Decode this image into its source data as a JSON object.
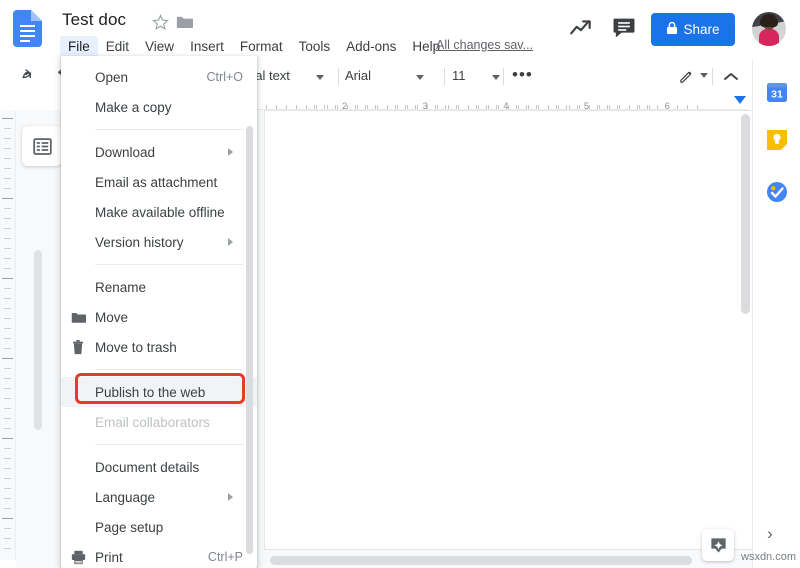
{
  "header": {
    "doc_title": "Test doc",
    "save_status": "All changes sav...",
    "share_label": "Share",
    "docs_icon": "google-docs-icon",
    "star_icon": "star-outline-icon",
    "folder_icon": "folder-icon",
    "trend_icon": "activity-dashboard-icon",
    "comment_icon": "comment-history-icon",
    "lock_icon": "lock-icon",
    "avatar_icon": "user-avatar"
  },
  "menubar": {
    "items": [
      {
        "label": "File",
        "active": true
      },
      {
        "label": "Edit",
        "active": false
      },
      {
        "label": "View",
        "active": false
      },
      {
        "label": "Insert",
        "active": false
      },
      {
        "label": "Format",
        "active": false
      },
      {
        "label": "Tools",
        "active": false
      },
      {
        "label": "Add-ons",
        "active": false
      },
      {
        "label": "Help",
        "active": false
      }
    ]
  },
  "toolbar": {
    "undo_icon": "undo-icon",
    "redo_icon": "redo-icon",
    "paragraph_style": "nal text",
    "font_family": "Arial",
    "font_size": "11",
    "more_label": "•••",
    "pencil_icon": "edit-mode-pencil-icon",
    "chevron_icon": "collapse-chevron-icon"
  },
  "ruler": {
    "numbers": [
      "2",
      "3",
      "4",
      "5",
      "6"
    ]
  },
  "file_menu": {
    "items": [
      {
        "label": "Open",
        "accel": "Ctrl+O",
        "icon": "",
        "arrow": false,
        "disabled": false,
        "highlight": false,
        "sep_after": false
      },
      {
        "label": "Make a copy",
        "accel": "",
        "icon": "",
        "arrow": false,
        "disabled": false,
        "highlight": false,
        "sep_after": true
      },
      {
        "label": "Download",
        "accel": "",
        "icon": "",
        "arrow": true,
        "disabled": false,
        "highlight": false,
        "sep_after": false
      },
      {
        "label": "Email as attachment",
        "accel": "",
        "icon": "",
        "arrow": false,
        "disabled": false,
        "highlight": false,
        "sep_after": false
      },
      {
        "label": "Make available offline",
        "accel": "",
        "icon": "",
        "arrow": false,
        "disabled": false,
        "highlight": false,
        "sep_after": false
      },
      {
        "label": "Version history",
        "accel": "",
        "icon": "",
        "arrow": true,
        "disabled": false,
        "highlight": false,
        "sep_after": true
      },
      {
        "label": "Rename",
        "accel": "",
        "icon": "",
        "arrow": false,
        "disabled": false,
        "highlight": false,
        "sep_after": false
      },
      {
        "label": "Move",
        "accel": "",
        "icon": "folder-icon",
        "arrow": false,
        "disabled": false,
        "highlight": false,
        "sep_after": false
      },
      {
        "label": "Move to trash",
        "accel": "",
        "icon": "trash-icon",
        "arrow": false,
        "disabled": false,
        "highlight": false,
        "sep_after": true
      },
      {
        "label": "Publish to the web",
        "accel": "",
        "icon": "",
        "arrow": false,
        "disabled": false,
        "highlight": true,
        "sep_after": false
      },
      {
        "label": "Email collaborators",
        "accel": "",
        "icon": "",
        "arrow": false,
        "disabled": true,
        "highlight": false,
        "sep_after": true
      },
      {
        "label": "Document details",
        "accel": "",
        "icon": "",
        "arrow": false,
        "disabled": false,
        "highlight": false,
        "sep_after": false
      },
      {
        "label": "Language",
        "accel": "",
        "icon": "",
        "arrow": true,
        "disabled": false,
        "highlight": false,
        "sep_after": false
      },
      {
        "label": "Page setup",
        "accel": "",
        "icon": "",
        "arrow": false,
        "disabled": false,
        "highlight": false,
        "sep_after": false
      },
      {
        "label": "Print",
        "accel": "Ctrl+P",
        "icon": "printer-icon",
        "arrow": false,
        "disabled": false,
        "highlight": false,
        "sep_after": false
      }
    ]
  },
  "annotation": {
    "target_label": "Publish to the web",
    "color": "#e8392c"
  },
  "left_panel": {
    "outline_icon": "document-outline-icon"
  },
  "right_sidebar": {
    "items": [
      {
        "icon": "google-calendar-icon",
        "label": "Calendar"
      },
      {
        "icon": "google-keep-icon",
        "label": "Keep"
      },
      {
        "icon": "google-tasks-icon",
        "label": "Tasks"
      }
    ],
    "expand_label": "›"
  },
  "footer": {
    "explore_icon": "explore-icon",
    "watermark": "wsxdn.com"
  }
}
